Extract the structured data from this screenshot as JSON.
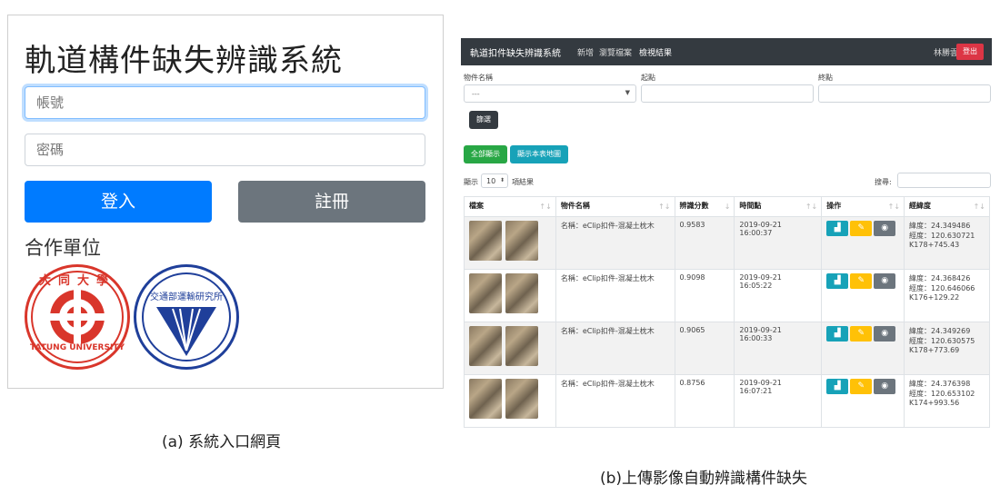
{
  "panel_a": {
    "title": "軌道構件缺失辨識系統",
    "account_placeholder": "帳號",
    "password_placeholder": "密碼",
    "login_label": "登入",
    "register_label": "註冊",
    "partners_label": "合作單位",
    "logo_tatung_text": "TATUNG UNIVERSITY",
    "logo_tatung_chars": "大同大學",
    "logo_iot_text": "交通部運輸研究所",
    "colors": {
      "primary": "#007bff",
      "secondary": "#6c757d",
      "tatung_red": "#d9362b",
      "iot_blue": "#1f3f9a"
    }
  },
  "panel_b": {
    "navbar": {
      "brand": "軌道扣件缺失辨識系統",
      "links": [
        "新增",
        "瀏覽檔案",
        "檢視結果"
      ],
      "user": "林勝雲",
      "logout": "登出"
    },
    "filters": {
      "name_label": "物件名稱",
      "name_value": "---",
      "start_label": "起點",
      "end_label": "終點",
      "query_button": "篩選"
    },
    "actions": {
      "show_all": "全部顯示",
      "show_map": "顯示本表地圖"
    },
    "length_prefix": "顯示",
    "length_value": "10",
    "length_suffix": "項結果",
    "search_label": "搜尋:",
    "columns": [
      "檔案",
      "物件名稱",
      "辨識分數",
      "時間點",
      "操作",
      "經緯度"
    ],
    "rows": [
      {
        "name": "名稱：eClip扣件-混凝土枕木",
        "score": "0.9583",
        "time": "2019-09-21 16:00:37",
        "lat": "緯度：24.349486",
        "lng": "經度：120.630721",
        "km": "K178+745.43"
      },
      {
        "name": "名稱：eClip扣件-混凝土枕木",
        "score": "0.9098",
        "time": "2019-09-21 16:05:22",
        "lat": "緯度：24.368426",
        "lng": "經度：120.646066",
        "km": "K176+129.22"
      },
      {
        "name": "名稱：eClip扣件-混凝土枕木",
        "score": "0.9065",
        "time": "2019-09-21 16:00:33",
        "lat": "緯度：24.349269",
        "lng": "經度：120.630575",
        "km": "K178+773.69"
      },
      {
        "name": "名稱：eClip扣件-混凝土枕木",
        "score": "0.8756",
        "time": "2019-09-21 16:07:21",
        "lat": "緯度：24.376398",
        "lng": "經度：120.653102",
        "km": "K174+993.56"
      }
    ],
    "colors": {
      "navbar": "#343a40",
      "danger": "#dc3545",
      "success": "#28a745",
      "info": "#17a2b8",
      "warning": "#ffc107",
      "dark": "#6c757d"
    }
  },
  "captions": {
    "a": "(a) 系統入口網頁",
    "b": "(b)上傳影像自動辨識構件缺失"
  }
}
